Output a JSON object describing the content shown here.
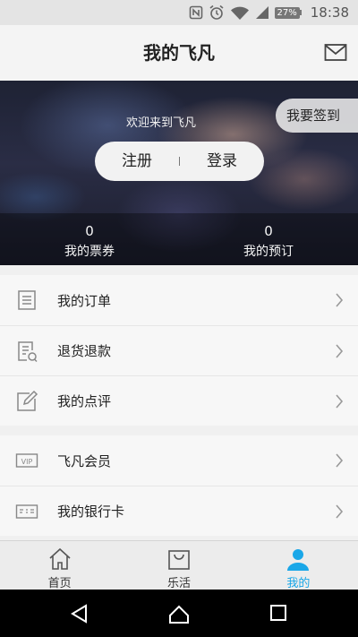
{
  "status_bar": {
    "battery": "27%",
    "time": "18:38"
  },
  "header": {
    "title": "我的飞凡",
    "mail_icon": "mail-icon"
  },
  "hero": {
    "welcome": "欢迎来到飞凡",
    "signin": "我要签到",
    "register": "注册",
    "login": "登录",
    "stats": [
      {
        "value": "0",
        "label": "我的票券"
      },
      {
        "value": "0",
        "label": "我的预订"
      }
    ]
  },
  "menu_group_1": [
    {
      "label": "我的订单",
      "icon": "order-list-icon"
    },
    {
      "label": "退货退款",
      "icon": "refund-icon"
    },
    {
      "label": "我的点评",
      "icon": "review-edit-icon"
    }
  ],
  "menu_group_2": [
    {
      "label": "飞凡会员",
      "icon": "vip-card-icon"
    },
    {
      "label": "我的银行卡",
      "icon": "bank-card-icon"
    }
  ],
  "tabs": [
    {
      "label": "首页",
      "icon": "home-icon"
    },
    {
      "label": "乐活",
      "icon": "shopping-bag-icon"
    },
    {
      "label": "我的",
      "icon": "profile-icon",
      "active": true
    }
  ],
  "colors": {
    "accent": "#1aa7e8"
  }
}
